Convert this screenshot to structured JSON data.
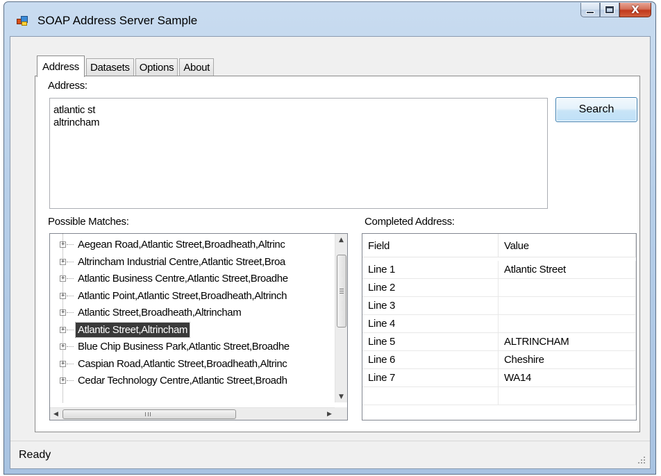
{
  "window": {
    "title": "SOAP Address Server Sample",
    "controls": {
      "minimize": "minimize-icon",
      "maximize": "maximize-icon",
      "close_glyph": "X"
    }
  },
  "tabs": [
    {
      "label": "Address",
      "active": true
    },
    {
      "label": "Datasets",
      "active": false
    },
    {
      "label": "Options",
      "active": false
    },
    {
      "label": "About",
      "active": false
    }
  ],
  "address": {
    "label": "Address:",
    "lines": [
      "atlantic st",
      "altrincham"
    ],
    "search_label": "Search"
  },
  "matches": {
    "label": "Possible Matches:",
    "items": [
      "Aegean Road,Atlantic Street,Broadheath,Altrinc",
      "Altrincham Industrial Centre,Atlantic Street,Broa",
      "Atlantic Business Centre,Atlantic Street,Broadhe",
      "Atlantic Point,Atlantic Street,Broadheath,Altrinch",
      "Atlantic Street,Broadheath,Altrincham",
      "Atlantic Street,Altrincham",
      "Blue Chip Business Park,Atlantic Street,Broadhe",
      "Caspian Road,Atlantic Street,Broadheath,Altrinc",
      "Cedar Technology Centre,Atlantic Street,Broadh"
    ],
    "selected_index": 5,
    "expander_glyph": "+",
    "scroll_up_glyph": "▲",
    "scroll_down_glyph": "▼",
    "scroll_left_glyph": "◀",
    "scroll_right_glyph": "▶"
  },
  "completed": {
    "label": "Completed Address:",
    "columns": [
      "Field",
      "Value"
    ],
    "rows": [
      [
        "Line 1",
        "Atlantic Street"
      ],
      [
        "Line 2",
        ""
      ],
      [
        "Line 3",
        ""
      ],
      [
        "Line 4",
        ""
      ],
      [
        "Line 5",
        "ALTRINCHAM"
      ],
      [
        "Line 6",
        "Cheshire"
      ],
      [
        "Line 7",
        "WA14"
      ],
      [
        "",
        ""
      ]
    ]
  },
  "status": {
    "text": "Ready"
  },
  "colors": {
    "title_gradient": "#b7cfe9",
    "selection": "#3a3a3a",
    "close_button": "#c2391c"
  }
}
